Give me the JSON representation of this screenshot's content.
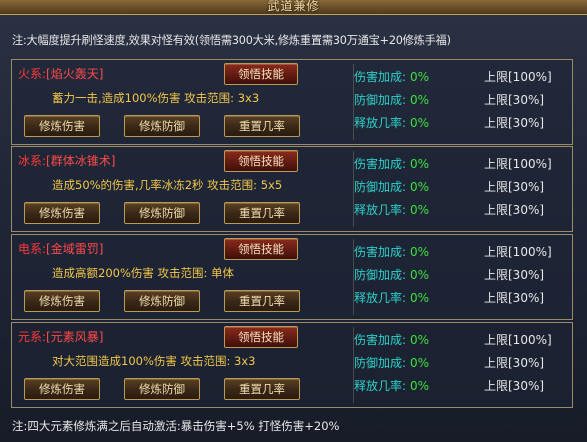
{
  "window": {
    "title": "武道兼修"
  },
  "note": "注:大幅度提升刷怪速度,效果对怪有效(领悟需300大米,修炼重置需30万通宝+20修炼手福)",
  "footer": "注:四大元素修炼满之后自动激活:暴击伤害+5%  打怪伤害+20%",
  "colors": {
    "element_red": "#ff3a3a",
    "desc_gold": "#f2c64a",
    "stat_cyan": "#2fd0c8",
    "value_green": "#3ee03e"
  },
  "panels": [
    {
      "element": "火系:",
      "skill": "[焰火轰天]",
      "desc": "蓄力一击,造成100%伤害    攻击范围: 3x3",
      "learn": "领悟技能",
      "train_attack": "修炼伤害",
      "train_defense": "修炼防御",
      "reset": "重置几率",
      "stats": [
        {
          "label": "伤害加成:",
          "value": "0%",
          "limit": "上限[100%]"
        },
        {
          "label": "防御加成:",
          "value": "0%",
          "limit": "上限[30%]"
        },
        {
          "label": "释放几率:",
          "value": "0%",
          "limit": "上限[30%]"
        }
      ]
    },
    {
      "element": "冰系:",
      "skill": "[群体冰锥术]",
      "desc": "造成50%的伤害,几率冰冻2秒  攻击范围: 5x5",
      "learn": "领悟技能",
      "train_attack": "修炼伤害",
      "train_defense": "修炼防御",
      "reset": "重置几率",
      "stats": [
        {
          "label": "伤害加成:",
          "value": "0%",
          "limit": "上限[100%]"
        },
        {
          "label": "防御加成:",
          "value": "0%",
          "limit": "上限[30%]"
        },
        {
          "label": "释放几率:",
          "value": "0%",
          "limit": "上限[30%]"
        }
      ]
    },
    {
      "element": "电系:",
      "skill": "[金域雷罚]",
      "desc": "造成高额200%伤害    攻击范围: 单体",
      "learn": "领悟技能",
      "train_attack": "修炼伤害",
      "train_defense": "修炼防御",
      "reset": "重置几率",
      "stats": [
        {
          "label": "伤害加成:",
          "value": "0%",
          "limit": "上限[100%]"
        },
        {
          "label": "防御加成:",
          "value": "0%",
          "limit": "上限[30%]"
        },
        {
          "label": "释放几率:",
          "value": "0%",
          "limit": "上限[30%]"
        }
      ]
    },
    {
      "element": "元系:",
      "skill": "[元素风暴]",
      "desc": "对大范围造成100%伤害    攻击范围: 3x3",
      "learn": "领悟技能",
      "train_attack": "修炼伤害",
      "train_defense": "修炼防御",
      "reset": "重置几率",
      "stats": [
        {
          "label": "伤害加成:",
          "value": "0%",
          "limit": "上限[100%]"
        },
        {
          "label": "防御加成:",
          "value": "0%",
          "limit": "上限[30%]"
        },
        {
          "label": "释放几率:",
          "value": "0%",
          "limit": "上限[30%]"
        }
      ]
    }
  ]
}
